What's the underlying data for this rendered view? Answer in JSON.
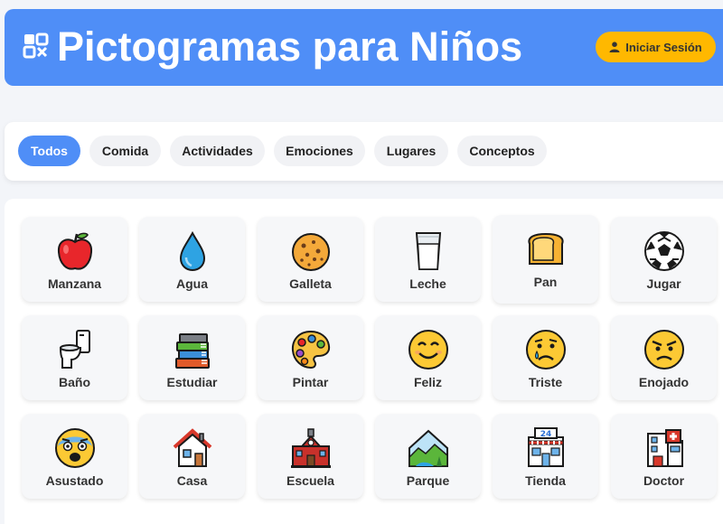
{
  "header": {
    "title": "Pictogramas para Niños",
    "login_label": "Iniciar Sesión",
    "brand_color": "#4f8ef7",
    "login_color": "#ffb800"
  },
  "tabs": [
    {
      "label": "Todos",
      "active": true
    },
    {
      "label": "Comida",
      "active": false
    },
    {
      "label": "Actividades",
      "active": false
    },
    {
      "label": "Emociones",
      "active": false
    },
    {
      "label": "Lugares",
      "active": false
    },
    {
      "label": "Conceptos",
      "active": false
    }
  ],
  "pictograms": [
    {
      "label": "Manzana",
      "icon": "apple-icon"
    },
    {
      "label": "Agua",
      "icon": "water-drop-icon"
    },
    {
      "label": "Galleta",
      "icon": "cookie-icon"
    },
    {
      "label": "Leche",
      "icon": "milk-glass-icon"
    },
    {
      "label": "Pan",
      "icon": "bread-icon"
    },
    {
      "label": "Jugar",
      "icon": "soccer-ball-icon"
    },
    {
      "label": "Baño",
      "icon": "toilet-icon"
    },
    {
      "label": "Estudiar",
      "icon": "books-icon"
    },
    {
      "label": "Pintar",
      "icon": "palette-icon"
    },
    {
      "label": "Feliz",
      "icon": "happy-face-icon"
    },
    {
      "label": "Triste",
      "icon": "sad-face-icon"
    },
    {
      "label": "Enojado",
      "icon": "angry-face-icon"
    },
    {
      "label": "Asustado",
      "icon": "scared-face-icon"
    },
    {
      "label": "Casa",
      "icon": "house-icon"
    },
    {
      "label": "Escuela",
      "icon": "school-icon"
    },
    {
      "label": "Parque",
      "icon": "park-icon"
    },
    {
      "label": "Tienda",
      "icon": "store-icon"
    },
    {
      "label": "Doctor",
      "icon": "hospital-icon"
    }
  ]
}
